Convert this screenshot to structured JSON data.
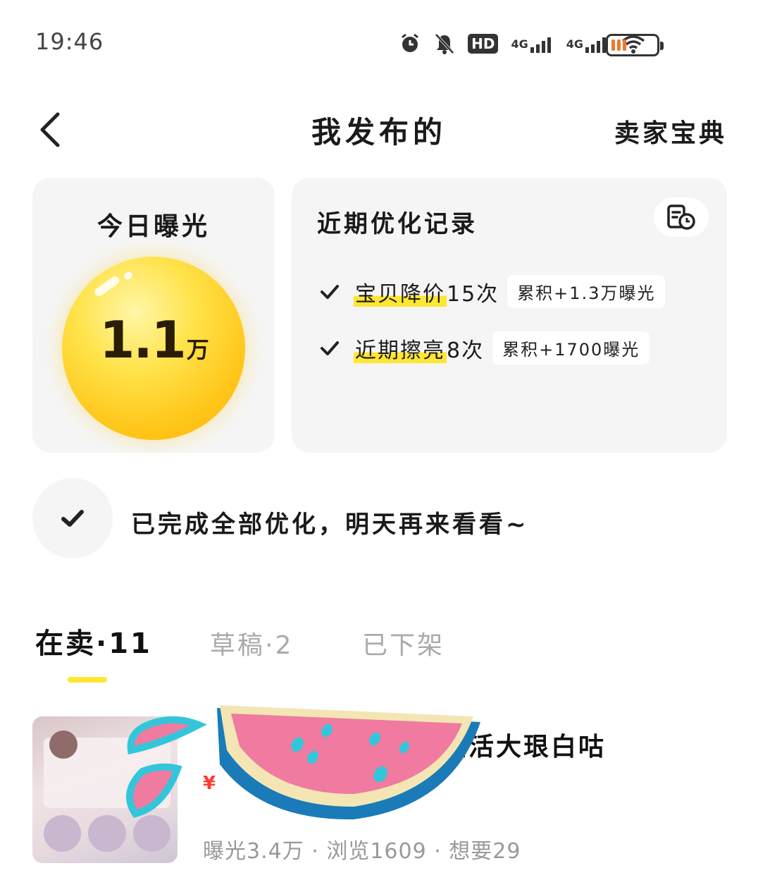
{
  "status_bar": {
    "time": "19:46",
    "icons": [
      "alarm-icon",
      "mute-icon",
      "hd-icon",
      "signal-4g-icon",
      "signal-4g-icon",
      "wifi-icon",
      "battery-icon"
    ],
    "hd_label": "HD",
    "net1": "4G",
    "net2": "4G"
  },
  "nav": {
    "title": "我发布的",
    "right_link": "卖家宝典"
  },
  "exposure_card": {
    "title": "今日曝光",
    "value": "1.1",
    "unit": "万"
  },
  "optimization_card": {
    "title": "近期优化记录",
    "records": [
      {
        "highlight": "宝贝降价",
        "count": "15次",
        "tag": "累积+1.3万曝光"
      },
      {
        "highlight": "近期擦亮",
        "count": "8次",
        "tag": "累积+1700曝光"
      }
    ]
  },
  "completion": {
    "text": "已完成全部优化，明天再来看看~"
  },
  "tabs": [
    {
      "label": "在卖·11",
      "active": true
    },
    {
      "label": "草稿·2",
      "active": false
    },
    {
      "label": "已下架",
      "active": false
    }
  ],
  "product": {
    "title_visible": "全活大珢白咕",
    "price_symbol": "¥",
    "stats": "曝光3.4万 · 浏览1609 · 想要29"
  },
  "colors": {
    "accent_yellow": "#ffe633",
    "price_red": "#ff3b30",
    "card_bg": "#f5f5f5"
  }
}
